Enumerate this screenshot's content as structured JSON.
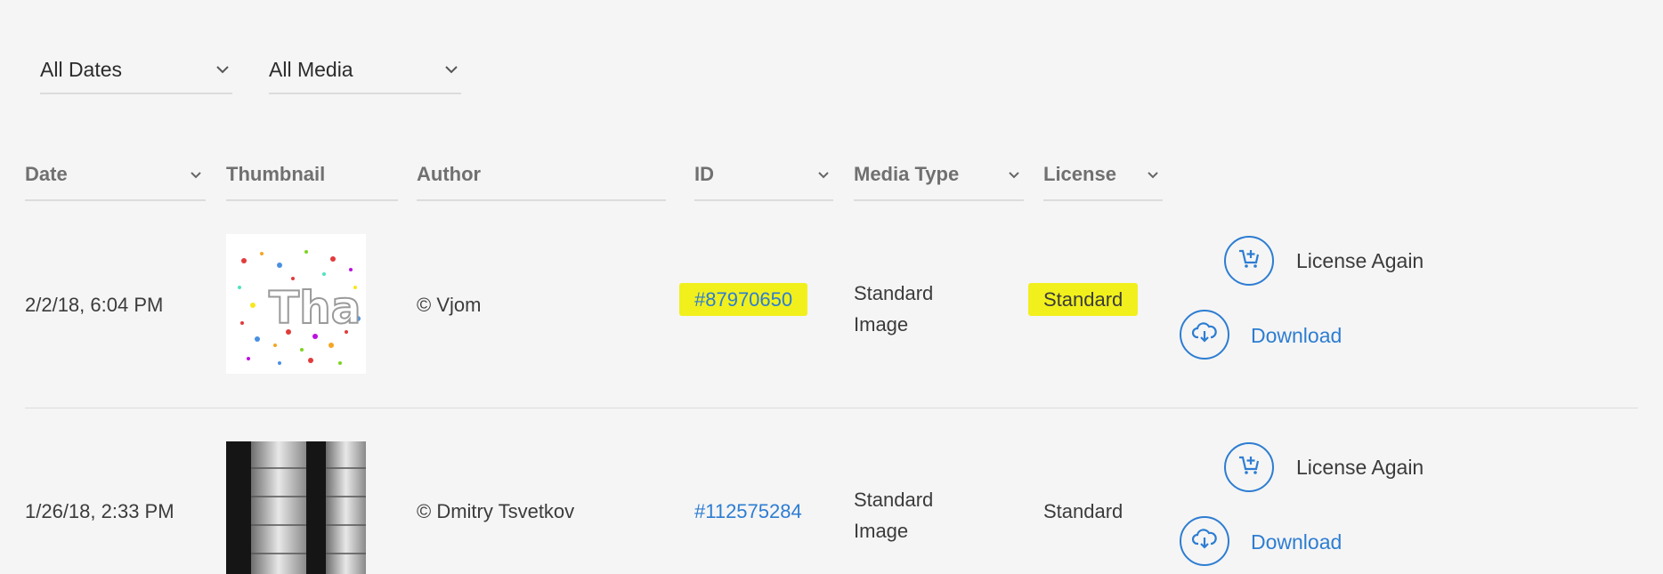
{
  "filters": {
    "dates_label": "All Dates",
    "media_label": "All Media"
  },
  "columns": {
    "date": "Date",
    "thumbnail": "Thumbnail",
    "author": "Author",
    "id": "ID",
    "media_type": "Media Type",
    "license": "License"
  },
  "rows": [
    {
      "date": "2/2/18, 6:04 PM",
      "author": "© Vjom",
      "id": "#87970650",
      "media_type_line1": "Standard",
      "media_type_line2": "Image",
      "license": "Standard",
      "thumbnail_text": "Tha",
      "license_again_label": "License Again",
      "download_label": "Download"
    },
    {
      "date": "1/26/18, 2:33 PM",
      "author": "© Dmitry Tsvetkov",
      "id": "#112575284",
      "media_type_line1": "Standard",
      "media_type_line2": "Image",
      "license": "Standard",
      "license_again_label": "License Again",
      "download_label": "Download"
    }
  ],
  "icons": {
    "chevron": "chevron-down-icon",
    "cart": "cart-add-icon",
    "cloud": "cloud-download-icon"
  },
  "colors": {
    "accent": "#2d7dd2",
    "highlight": "#f1f01c",
    "background": "#f5f5f5"
  }
}
